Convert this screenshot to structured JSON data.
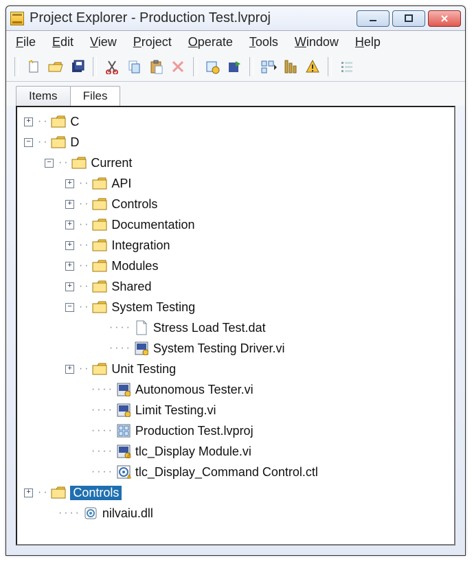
{
  "window": {
    "title": "Project Explorer - Production Test.lvproj"
  },
  "menu": {
    "file": "File",
    "edit": "Edit",
    "view": "View",
    "project": "Project",
    "operate": "Operate",
    "tools": "Tools",
    "window": "Window",
    "help": "Help"
  },
  "tabs": {
    "items": "Items",
    "files": "Files",
    "active": "Files"
  },
  "tree": {
    "c": {
      "label": "C"
    },
    "d": {
      "label": "D"
    },
    "current": {
      "label": "Current"
    },
    "api": {
      "label": "API"
    },
    "controls1": {
      "label": "Controls"
    },
    "doc": {
      "label": "Documentation"
    },
    "integ": {
      "label": "Integration"
    },
    "modules": {
      "label": "Modules"
    },
    "shared": {
      "label": "Shared"
    },
    "systest": {
      "label": "System Testing"
    },
    "stress": {
      "label": "Stress Load Test.dat"
    },
    "sysdrv": {
      "label": "System Testing Driver.vi"
    },
    "unit": {
      "label": "Unit Testing"
    },
    "auto": {
      "label": "Autonomous Tester.vi"
    },
    "limit": {
      "label": "Limit Testing.vi"
    },
    "proj": {
      "label": "Production Test.lvproj"
    },
    "disp": {
      "label": "tlc_Display Module.vi"
    },
    "dispcmd": {
      "label": "tlc_Display_Command Control.ctl"
    },
    "controls2": {
      "label": "Controls"
    },
    "dll": {
      "label": "nilvaiu.dll"
    }
  }
}
